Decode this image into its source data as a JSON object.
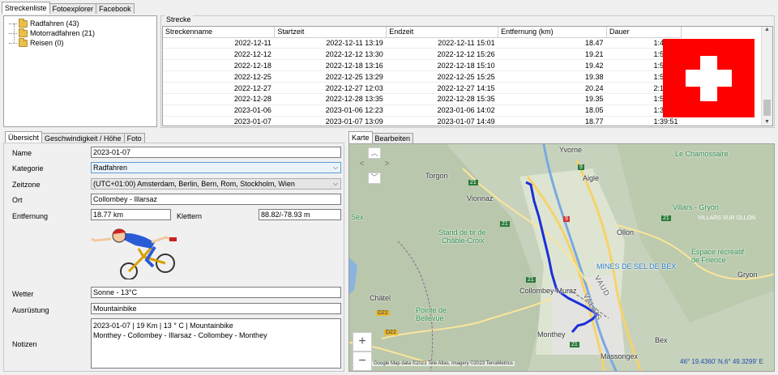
{
  "top_tabs": [
    "Streckenliste",
    "Fotoexplorer",
    "Facebook"
  ],
  "tree": [
    {
      "label": "Radfahren (43)"
    },
    {
      "label": "Motorradfahren (21)"
    },
    {
      "label": "Reisen (0)"
    }
  ],
  "strecke": {
    "group_label": "Strecke",
    "columns": [
      "Streckenname",
      "Startzeit",
      "Endzeit",
      "Entfernung (km)",
      "Dauer"
    ],
    "rows": [
      [
        "2022-12-11",
        "2022-12-11 13:19",
        "2022-12-11 15:01",
        "18.47",
        "1:42:31"
      ],
      [
        "2022-12-12",
        "2022-12-12 13:30",
        "2022-12-12 15:26",
        "19.21",
        "1:55:23"
      ],
      [
        "2022-12-18",
        "2022-12-18 13:16",
        "2022-12-18 15:10",
        "19.42",
        "1:54:14"
      ],
      [
        "2022-12-25",
        "2022-12-25 13:29",
        "2022-12-25 15:25",
        "19.38",
        "1:55:59"
      ],
      [
        "2022-12-27",
        "2022-12-27 12:03",
        "2022-12-27 14:15",
        "20.24",
        "2:12:02"
      ],
      [
        "2022-12-28",
        "2022-12-28 13:35",
        "2022-12-28 15:35",
        "19.35",
        "1:59:55"
      ],
      [
        "2023-01-06",
        "2023-01-06 12:23",
        "2023-01-06 14:02",
        "18.05",
        "1:38:40"
      ],
      [
        "2023-01-07",
        "2023-01-07 13:09",
        "2023-01-07 14:49",
        "18.77",
        "1:39:51"
      ]
    ],
    "flag_color": "#ff0000"
  },
  "detail_tabs": [
    "Übersicht",
    "Geschwindigkeit / Höhe",
    "Foto"
  ],
  "detail": {
    "name_label": "Name",
    "name": "2023-01-07",
    "kategorie_label": "Kategorie",
    "kategorie": "Radfahren",
    "zeitzone_label": "Zeitzone",
    "zeitzone": "(UTC+01:00) Amsterdam, Berlin, Bern, Rom, Stockholm, Wien",
    "ort_label": "Ort",
    "ort": "Collombey - Illarsaz",
    "entfernung_label": "Entfernung",
    "entfernung": "18.77 km",
    "klettern_label": "Klettern",
    "klettern": "88.82/-78.93 m",
    "wetter_label": "Wetter",
    "wetter": "Sonne  -  13°C",
    "ausruestung_label": "Ausrüstung",
    "ausruestung": "Mountainbike",
    "notizen_label": "Notizen",
    "notizen_line1": "2023-01-07  | 19 Km | 13 ° C | Mountainbike",
    "notizen_line2": "Monthey - Collombey - Illarsaz - Collombey - Monthey"
  },
  "map_tabs": [
    "Karte",
    "Bearbeiten"
  ],
  "map": {
    "places": [
      "Yvorne",
      "Aigle",
      "Torgon",
      "Vionnaz",
      "Le Chamossaire",
      "Villars - Gryon",
      "VILLARS SUR OLLON",
      "Ollon",
      "Sex",
      "Stand de tir de",
      "Châble-Croix",
      "MINES DE SEL DE BEX",
      "Espace récréatif",
      "de Frience",
      "Gryon",
      "Collombey-Muraz",
      "VAUD",
      "VALAIS",
      "Châtel",
      "Pointe de",
      "Bellevue",
      "Monthey",
      "Bex",
      "Massongex"
    ],
    "roads": [
      "9",
      "9",
      "21",
      "21",
      "21",
      "21",
      "21",
      "D22",
      "D22"
    ],
    "attribution": "Google  Map data ©2023 Tele Atlas, Imagery ©2023 TerraMetrics",
    "coordinates": "46° 19.4360' N,6° 49.3299' E",
    "zoom_in": "+",
    "zoom_out": "−",
    "track_color": "#1a2fd8"
  }
}
